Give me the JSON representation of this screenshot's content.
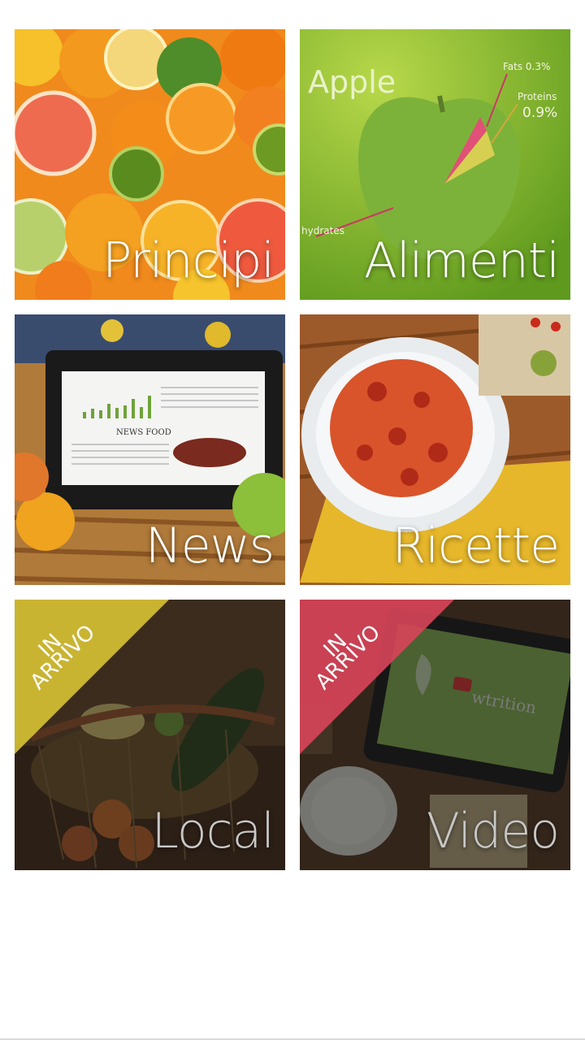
{
  "tiles": [
    {
      "label": "Principi",
      "badge": ""
    },
    {
      "label": "Alimenti",
      "badge": "",
      "overlay": {
        "title": "Apple",
        "fats": "Fats 0.3%",
        "proteins": "Proteins",
        "proteins_value": "0.9%",
        "carbs": "hydrates"
      }
    },
    {
      "label": "News",
      "badge": "",
      "tablet_title": "NEWS FOOD"
    },
    {
      "label": "Ricette",
      "badge": ""
    },
    {
      "label": "Local",
      "badge_line1": "IN",
      "badge_line2": "ARRIVO"
    },
    {
      "label": "Video",
      "badge_line1": "IN",
      "badge_line2": "ARRIVO",
      "tablet_brand": "wtrition"
    }
  ],
  "colors": {
    "badge_yellow": "#d9c334",
    "badge_red": "#d9455a",
    "green": "#8dbf3a"
  }
}
